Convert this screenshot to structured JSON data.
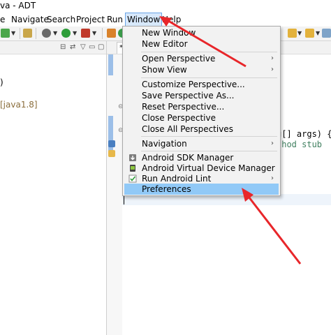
{
  "window": {
    "title": "va - ADT"
  },
  "menubar": [
    "e",
    "Navigate",
    "Search",
    "Project",
    "Run",
    "Window",
    "Help"
  ],
  "menubar_active": "Window",
  "left_panel": {
    "paren": ")",
    "library": "[java1.8]"
  },
  "editor": {
    "tab": "*",
    "code_lines": [
      "g[] args) {",
      "thod stub"
    ]
  },
  "window_menu": {
    "items": [
      {
        "label": "New Window",
        "submenu": false
      },
      {
        "label": "New Editor",
        "submenu": false
      },
      {
        "label": "Open Perspective",
        "submenu": true
      },
      {
        "label": "Show View",
        "submenu": true
      },
      {
        "label": "Customize Perspective...",
        "submenu": false
      },
      {
        "label": "Save Perspective As...",
        "submenu": false
      },
      {
        "label": "Reset Perspective...",
        "submenu": false
      },
      {
        "label": "Close Perspective",
        "submenu": false
      },
      {
        "label": "Close All Perspectives",
        "submenu": false
      },
      {
        "label": "Navigation",
        "submenu": true
      },
      {
        "label": "Android SDK Manager",
        "submenu": false,
        "icon": "android-sdk-manager-icon"
      },
      {
        "label": "Android Virtual Device Manager",
        "submenu": false,
        "icon": "android-device-icon"
      },
      {
        "label": "Run Android Lint",
        "submenu": true,
        "icon": "lint-check-icon"
      },
      {
        "label": "Preferences",
        "submenu": false
      }
    ],
    "highlighted": "Preferences"
  },
  "colors": {
    "highlight": "#91c9f7",
    "annotation_arrow": "#e8262a",
    "menubar_active": "#d7e8fb"
  },
  "annotations": [
    "red arrow pointing to Window menu",
    "red arrow pointing to Preferences"
  ]
}
